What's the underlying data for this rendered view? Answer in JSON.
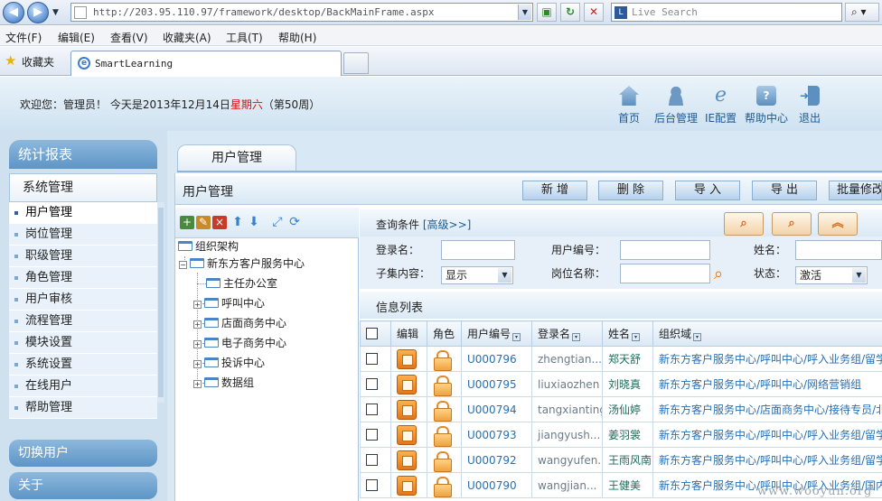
{
  "browser": {
    "url": "http://203.95.110.97/framework/desktop/BackMainFrame.aspx",
    "search_placeholder": "Live Search",
    "menu": [
      "文件(F)",
      "编辑(E)",
      "查看(V)",
      "收藏夹(A)",
      "工具(T)",
      "帮助(H)"
    ],
    "favorites_label": "收藏夹",
    "tab_title": "SmartLearning"
  },
  "header": {
    "welcome_prefix": "欢迎您：管理员！ 今天是2013年12月14日",
    "weekday": "星期六",
    "week_suffix": "（第50周）",
    "links": [
      {
        "label": "首页",
        "icon": "home-icon"
      },
      {
        "label": "后台管理",
        "icon": "admin-user-icon"
      },
      {
        "label": "IE配置",
        "icon": "ie-config-icon"
      },
      {
        "label": "帮助中心",
        "icon": "help-icon"
      },
      {
        "label": "退出",
        "icon": "logout-icon"
      }
    ]
  },
  "sidebar": {
    "stats_header": "统计报表",
    "system_header": "系统管理",
    "items": [
      "用户管理",
      "岗位管理",
      "职级管理",
      "角色管理",
      "用户审核",
      "流程管理",
      "模块设置",
      "系统设置",
      "在线用户",
      "帮助管理"
    ],
    "active_index": 0,
    "switch_user": "切换用户",
    "about": "关于"
  },
  "main": {
    "tab_label": "用户管理",
    "page_title": "用户管理",
    "buttons": [
      "新 增",
      "删 除",
      "导 入",
      "导 出",
      "批量修改"
    ]
  },
  "tree": {
    "root": "组织架构",
    "company": "新东方客户服务中心",
    "children": [
      "主任办公室",
      "呼叫中心",
      "店面商务中心",
      "电子商务中心",
      "投诉中心",
      "数据组"
    ]
  },
  "query": {
    "title": "查询条件",
    "advanced": "[高级>>]",
    "labels": {
      "login": "登录名：",
      "user_no": "用户编号：",
      "name": "姓名：",
      "subset": "子集内容：",
      "position": "岗位名称：",
      "status": "状态："
    },
    "subset_value": "显示",
    "status_value": "激活"
  },
  "list": {
    "title": "信息列表",
    "columns": [
      "编辑",
      "角色",
      "用户编号",
      "登录名",
      "姓名",
      "组织域"
    ],
    "rows": [
      {
        "user_no": "U000796",
        "login": "zhengtian...",
        "name": "郑天舒",
        "org": "新东方客户服务中心/呼叫中心/呼入业务组/留学"
      },
      {
        "user_no": "U000795",
        "login": "liuxiaozhen",
        "name": "刘晓真",
        "org": "新东方客户服务中心/呼叫中心/网络营销组"
      },
      {
        "user_no": "U000794",
        "login": "tangxianting",
        "name": "汤仙婷",
        "org": "新东方客户服务中心/店面商务中心/接待专员/北"
      },
      {
        "user_no": "U000793",
        "login": "jiangyush...",
        "name": "姜羽裳",
        "org": "新东方客户服务中心/呼叫中心/呼入业务组/留学"
      },
      {
        "user_no": "U000792",
        "login": "wangyufen...",
        "name": "王雨风南",
        "org": "新东方客户服务中心/呼叫中心/呼入业务组/留学"
      },
      {
        "user_no": "U000790",
        "login": "wangjian...",
        "name": "王健美",
        "org": "新东方客户服务中心/呼叫中心/呼入业务组/国内"
      }
    ]
  },
  "watermark": "www.wooyun.org"
}
